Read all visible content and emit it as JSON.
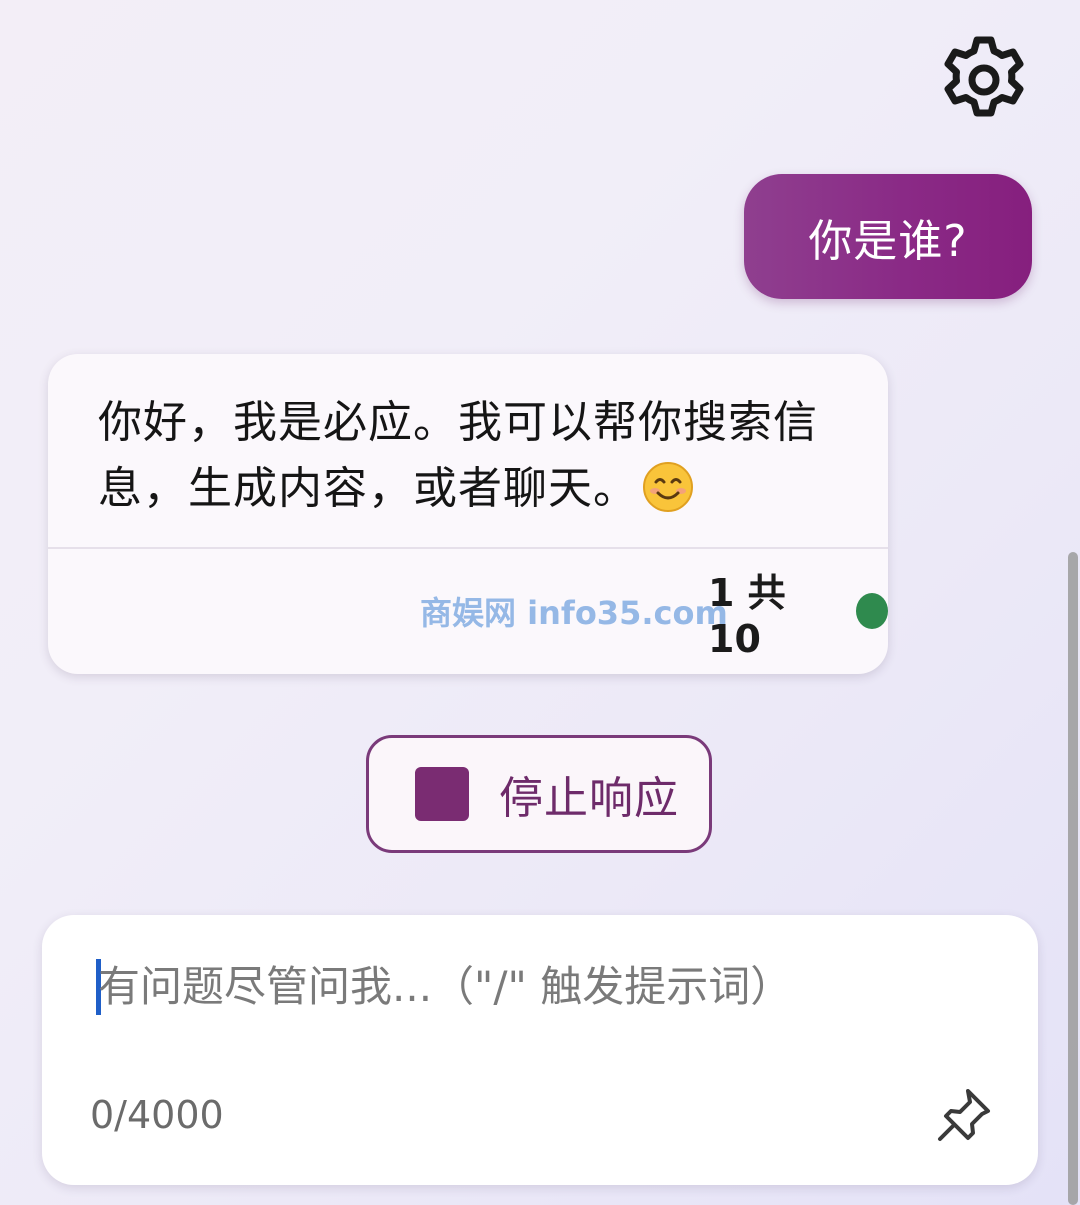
{
  "header": {
    "settings_icon": "gear-icon"
  },
  "conversation": {
    "user_message": "你是谁?",
    "bot_message": {
      "text": "你好，我是必应。我可以帮你搜索信息，生成内容，或者聊天。",
      "emoji": "smiling-face-icon",
      "counter": "1 共 10",
      "status_color": "#2f8a4e"
    },
    "watermark": "商娱网 info35.com"
  },
  "actions": {
    "stop_label": "停止响应",
    "stop_icon": "stop-square-icon"
  },
  "composer": {
    "placeholder": "有问题尽管问我...（\"/\" 触发提示词）",
    "value": "",
    "char_count": "0/4000",
    "pin_icon": "pin-icon"
  },
  "colors": {
    "accent": "#8a2a86",
    "stop_accent": "#7a2c72"
  }
}
